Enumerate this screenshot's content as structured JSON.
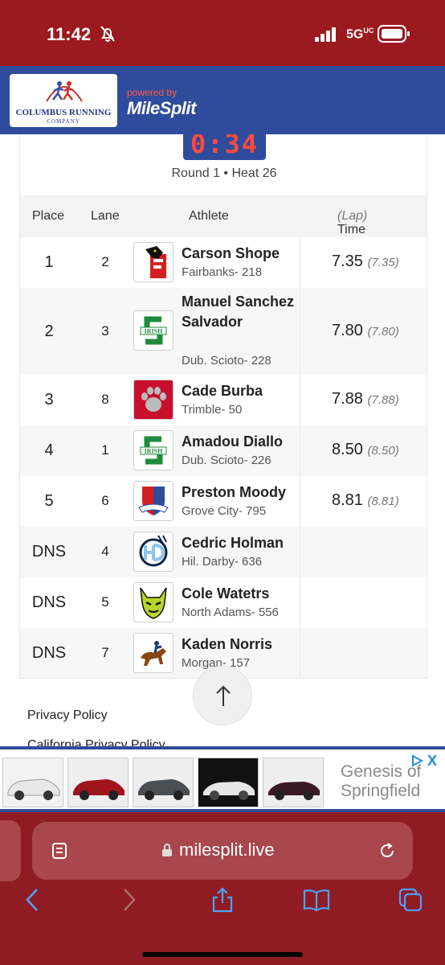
{
  "status_bar": {
    "time": "11:42",
    "network": "5G",
    "network_sup": "UC"
  },
  "header": {
    "logo_title": "COLUMBUS RUNNING",
    "logo_subtitle": "COMPANY",
    "powered_by": "powered by",
    "brand": "MileSplit"
  },
  "race": {
    "timer": "0:34",
    "heat_label": "Round 1 • Heat 26"
  },
  "table": {
    "columns": {
      "place": "Place",
      "lane": "Lane",
      "athlete": "Athlete",
      "time": "Time",
      "lap": "(Lap)"
    },
    "rows": [
      {
        "place": "1",
        "lane": "2",
        "name": "Carson Shope",
        "team": "Fairbanks- 218",
        "time": "7.35",
        "lap": "(7.35)",
        "logo": "panther-logo-icon"
      },
      {
        "place": "2",
        "lane": "3",
        "name": "Manuel Sanchez Salvador",
        "team": "Dub. Scioto- 228",
        "time": "7.80",
        "lap": "(7.80)",
        "logo": "irish-s-logo-icon"
      },
      {
        "place": "3",
        "lane": "8",
        "name": "Cade Burba",
        "team": "Trimble- 50",
        "time": "7.88",
        "lap": "(7.88)",
        "logo": "paw-logo-icon"
      },
      {
        "place": "4",
        "lane": "1",
        "name": "Amadou Diallo",
        "team": "Dub. Scioto- 226",
        "time": "8.50",
        "lap": "(8.50)",
        "logo": "irish-s-logo-icon"
      },
      {
        "place": "5",
        "lane": "6",
        "name": "Preston Moody",
        "team": "Grove City- 795",
        "time": "8.81",
        "lap": "(8.81)",
        "logo": "shield-logo-icon"
      },
      {
        "place": "DNS",
        "lane": "4",
        "name": "Cedric Holman",
        "team": "Hil. Darby- 636",
        "time": "",
        "lap": "",
        "logo": "hd-logo-icon"
      },
      {
        "place": "DNS",
        "lane": "5",
        "name": "Cole Watetrs",
        "team": "North Adams- 556",
        "time": "",
        "lap": "",
        "logo": "devil-logo-icon"
      },
      {
        "place": "DNS",
        "lane": "7",
        "name": "Kaden Norris",
        "team": "Morgan- 157",
        "time": "",
        "lap": "",
        "logo": "rider-logo-icon"
      }
    ]
  },
  "footer": {
    "privacy": "Privacy Policy",
    "ca_privacy": "California Privacy Policy"
  },
  "ad": {
    "brand_line1": "Genesis of",
    "brand_line2": "Springfield",
    "close": "X"
  },
  "browser": {
    "url": "milesplit.live"
  },
  "colors": {
    "header_blue": "#2f4c9c",
    "status_red": "#9b1a1f",
    "timer_red": "#ff4a3d",
    "browser_red": "#8e1c22"
  }
}
